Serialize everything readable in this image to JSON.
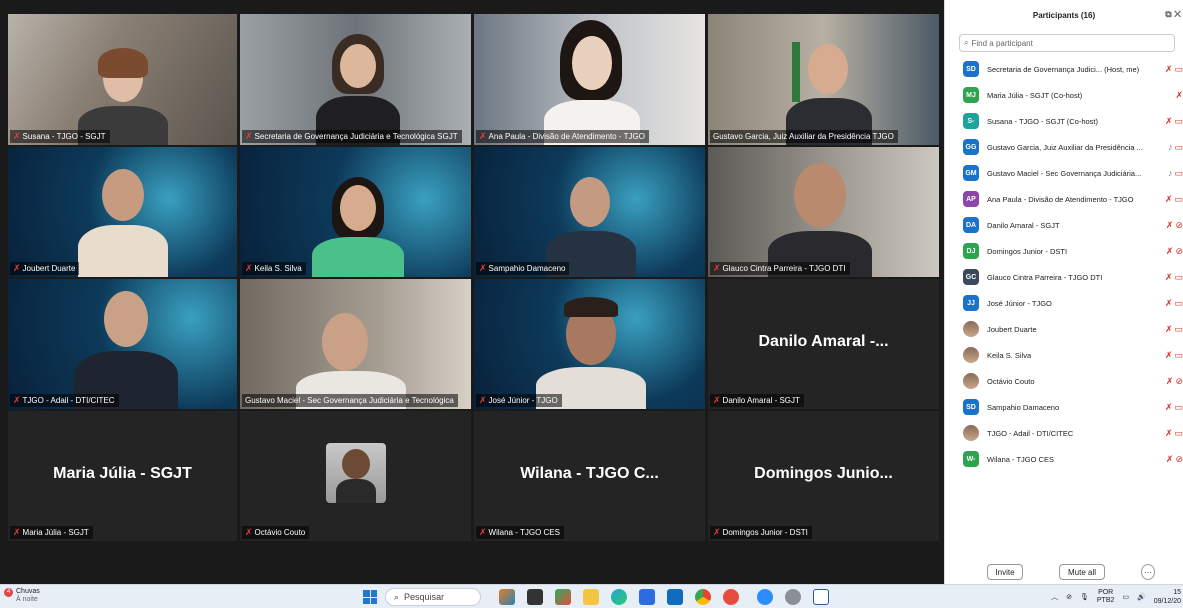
{
  "tiles": [
    {
      "label": "Susana - TJGO - SGJT",
      "muted": true
    },
    {
      "label": "Secretaria de Governança Judiciária e Tecnológica SGJT",
      "muted": true
    },
    {
      "label": "Ana Paula - Divisão de Atendimento - TJGO",
      "muted": true
    },
    {
      "label": "Gustavo Garcia, Juiz Auxiliar da Presidência TJGO",
      "muted": false
    },
    {
      "label": "Joubert Duarte",
      "muted": true
    },
    {
      "label": "Keila S. Silva",
      "muted": true
    },
    {
      "label": "Sampahio Damaceno",
      "muted": true
    },
    {
      "label": "Glauco Cintra Parreira - TJGO DTI",
      "muted": true
    },
    {
      "label": "TJGO - Adail - DTI/CITEC",
      "muted": true
    },
    {
      "label": "Gustavo Maciel - Sec Governança Judiciária e Tecnológica",
      "muted": false
    },
    {
      "label": "José Júnior - TJGO",
      "muted": true
    },
    {
      "label": "Danilo Amaral - SGJT",
      "muted": true,
      "big": "Danilo Amaral -..."
    },
    {
      "label": "Maria Júlia - SGJT",
      "muted": true,
      "big": "Maria Júlia - SGJT"
    },
    {
      "label": "Octávio Couto",
      "muted": true
    },
    {
      "label": "Wilana - TJGO CES",
      "muted": true,
      "big": "Wilana - TJGO C..."
    },
    {
      "label": "Domingos Junior - DSTI",
      "muted": true,
      "big": "Domingos Junio..."
    }
  ],
  "panel": {
    "title": "Participants (16)",
    "search_placeholder": "Find a participant",
    "participants": [
      {
        "initials": "SD",
        "color": "#1a73c9",
        "name": "Secretaria de Governança Judici...  (Host, me)",
        "mic": "off",
        "cam": "on"
      },
      {
        "initials": "MJ",
        "color": "#2ea44f",
        "name": "Maria Júlia - SGJT (Co-host)",
        "mic": "off",
        "cam": ""
      },
      {
        "initials": "S-",
        "color": "#1ba39c",
        "name": "Susana - TJGO - SGJT (Co-host)",
        "mic": "off",
        "cam": "on"
      },
      {
        "initials": "GG",
        "color": "#1a73c9",
        "name": "Gustavo Garcia, Juiz Auxiliar da Presidência ...",
        "mic": "on",
        "cam": "on"
      },
      {
        "initials": "GM",
        "color": "#1a73c9",
        "name": "Gustavo Maciel - Sec Governança Judiciária...",
        "mic": "on",
        "cam": "on"
      },
      {
        "initials": "AP",
        "color": "#8e44ad",
        "name": "Ana Paula - Divisão de Atendimento - TJGO",
        "mic": "off",
        "cam": "on"
      },
      {
        "initials": "DA",
        "color": "#1a73c9",
        "name": "Danilo Amaral - SGJT",
        "mic": "off",
        "cam": "off"
      },
      {
        "initials": "DJ",
        "color": "#2ea44f",
        "name": "Domingos Junior - DSTI",
        "mic": "off",
        "cam": "off"
      },
      {
        "initials": "GC",
        "color": "#3a4a5a",
        "name": "Glauco Cintra Parreira - TJGO DTI",
        "mic": "off",
        "cam": "on"
      },
      {
        "initials": "JJ",
        "color": "#1a73c9",
        "name": "José Júnior - TJGO",
        "mic": "off",
        "cam": "on"
      },
      {
        "initials": "",
        "color": "photo",
        "name": "Joubert Duarte",
        "mic": "off",
        "cam": "on"
      },
      {
        "initials": "",
        "color": "photo",
        "name": "Keila S. Silva",
        "mic": "off",
        "cam": "on"
      },
      {
        "initials": "",
        "color": "photo",
        "name": "Octávio Couto",
        "mic": "off",
        "cam": "off"
      },
      {
        "initials": "SD",
        "color": "#1a73c9",
        "name": "Sampahio Damaceno",
        "mic": "off",
        "cam": "on"
      },
      {
        "initials": "",
        "color": "photo",
        "name": "TJGO - Adail - DTI/CITEC",
        "mic": "off",
        "cam": "on"
      },
      {
        "initials": "W-",
        "color": "#2ea44f",
        "name": "Wilana - TJGO CES",
        "mic": "off",
        "cam": "off"
      }
    ],
    "invite_label": "Invite",
    "mute_all_label": "Mute all",
    "more_label": "···"
  },
  "taskbar": {
    "weather_title": "Chuvas",
    "weather_sub": "À noite",
    "weather_badge": "4",
    "search_label": "Pesquisar",
    "lang_top": "POR",
    "lang_bottom": "PTB2",
    "time": "15",
    "date": "09/12/20"
  },
  "icons": {
    "mic_off": "muted-mic-icon",
    "cam_off": "camera-off-icon",
    "search": "search-icon"
  }
}
